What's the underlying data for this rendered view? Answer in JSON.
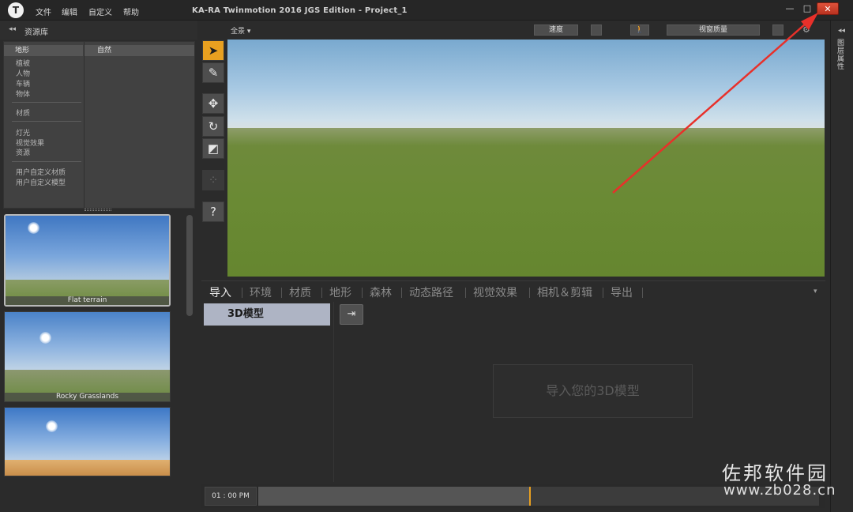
{
  "app": {
    "logo": "T",
    "title": "KA-RA Twinmotion 2016 JGS Edition - Project_1"
  },
  "menu": [
    "文件",
    "编辑",
    "自定义",
    "帮助"
  ],
  "window_controls": {
    "minimize": "—",
    "maximize": "□",
    "close": "✕"
  },
  "library": {
    "header": "资源库",
    "col_left_head": "地形",
    "col_right_head": "自然",
    "categories": [
      "植被",
      "人物",
      "车辆",
      "物体",
      "材质",
      "灯光",
      "视觉效果",
      "资源",
      "用户自定义材质",
      "用户自定义模型"
    ],
    "thumbnails": [
      {
        "caption": "Flat terrain",
        "selected": true
      },
      {
        "caption": "Rocky Grasslands",
        "selected": false
      },
      {
        "caption": "",
        "selected": false
      }
    ]
  },
  "tools": {
    "select": "select-arrow-icon",
    "paint": "paint-brush-icon",
    "move": "move-icon",
    "rotate": "rotate-icon",
    "scale": "scale-icon",
    "snap": "snap-grid-icon",
    "help": "?"
  },
  "viewport_toolbar": {
    "view_dropdown": "全景 ▾",
    "speed_button": "速度",
    "walk_icon": "walk-icon",
    "quality_button": "视窗质量",
    "settings_icon": "gear-icon"
  },
  "right_strip": {
    "label": "图层属性"
  },
  "bottom_tabs": [
    "导入",
    "环境",
    "材质",
    "地形",
    "森林",
    "动态路径",
    "视觉效果",
    "相机＆剪辑",
    "导出"
  ],
  "active_tab": "导入",
  "import_panel": {
    "item_label": "3D模型",
    "import_button_icon": "import-icon",
    "drop_hint": "导入您的3D模型"
  },
  "timeline": {
    "time": "01 : 00  PM",
    "progress": 0.483
  },
  "colors": {
    "accent": "#e8a020",
    "close_button": "#d9432d",
    "selected_item": "#aeb4c4"
  },
  "watermark": {
    "line1": "佐邦软件园",
    "line2": "www.zb028.cn"
  }
}
